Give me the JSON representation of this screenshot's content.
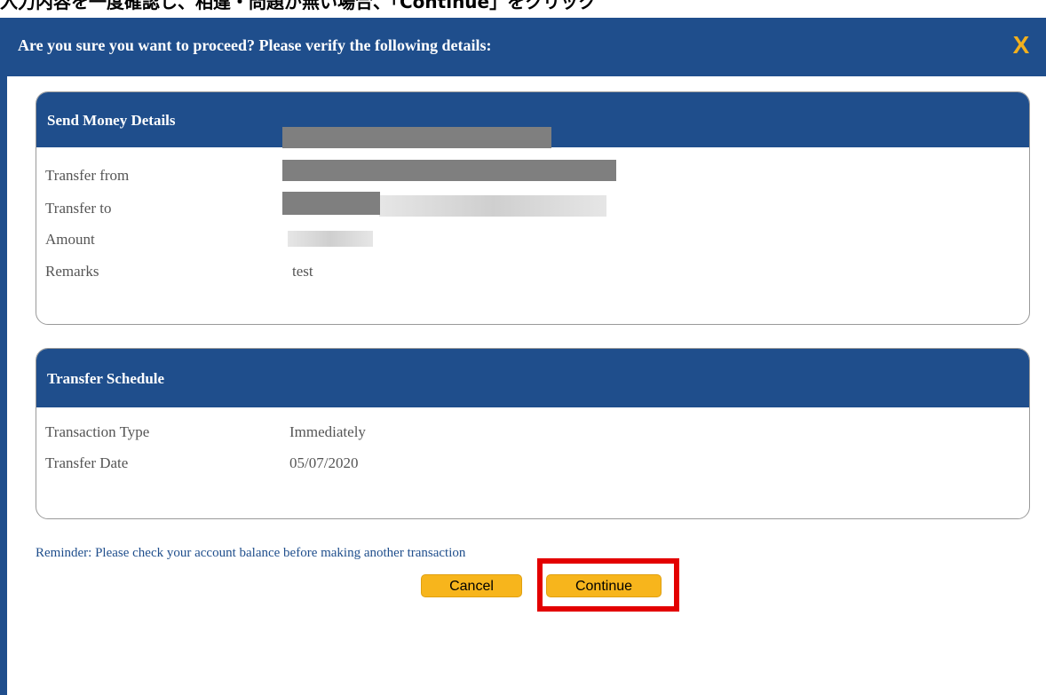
{
  "instruction": "入力内容を一度確認し、相違・問題が無い場合、「Continue」をクリック",
  "dialog": {
    "title": "Are you sure you want to proceed? Please verify the following details:",
    "close_label": "X"
  },
  "send_money_details": {
    "title": "Send Money Details",
    "rows": [
      {
        "label": "Transfer from",
        "value": ""
      },
      {
        "label": "Transfer to",
        "value": ""
      },
      {
        "label": "Amount",
        "value": ""
      },
      {
        "label": "Remarks",
        "value": "test"
      }
    ]
  },
  "transfer_schedule": {
    "title": "Transfer Schedule",
    "rows": [
      {
        "label": "Transaction Type",
        "value": "Immediately"
      },
      {
        "label": "Transfer Date",
        "value": "05/07/2020"
      }
    ]
  },
  "reminder": "Reminder: Please check your account balance before making another transaction",
  "buttons": {
    "cancel": "Cancel",
    "continue": "Continue"
  },
  "colors": {
    "header_blue": "#1f4e8c",
    "button_yellow": "#f7b51c",
    "highlight_red": "#e30000",
    "close_x": "#f2b01e"
  }
}
